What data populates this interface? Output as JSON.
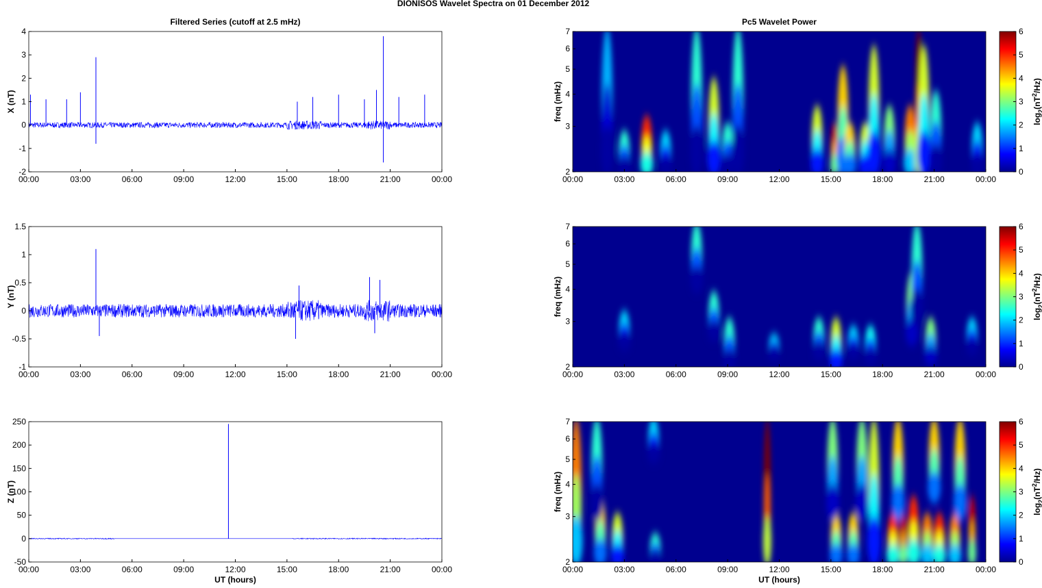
{
  "figure_title": "DIONISOS Wavelet Spectra on 01 December  2012",
  "chart_data": [
    {
      "type": "line",
      "title": "Filtered Series (cutoff at 2.5 mHz)",
      "ylabel": "X (nT)",
      "xlabel": "",
      "xlim": [
        0,
        24
      ],
      "ylim": [
        -2,
        4
      ],
      "xticks": [
        "00:00",
        "03:00",
        "06:00",
        "09:00",
        "12:00",
        "15:00",
        "18:00",
        "21:00",
        "00:00"
      ],
      "yticks": [
        -2,
        -1,
        0,
        1,
        2,
        3,
        4
      ],
      "noise_amplitude": 0.12,
      "spikes": [
        [
          3.9,
          2.9
        ],
        [
          3.9,
          -0.8
        ],
        [
          20.6,
          3.8
        ],
        [
          20.6,
          -1.6
        ],
        [
          0.1,
          1.3
        ],
        [
          1.0,
          1.1
        ],
        [
          2.2,
          1.1
        ],
        [
          3.0,
          1.4
        ],
        [
          15.6,
          1.0
        ],
        [
          16.5,
          1.2
        ],
        [
          18.0,
          1.3
        ],
        [
          19.5,
          1.1
        ],
        [
          20.2,
          1.5
        ],
        [
          21.5,
          1.2
        ],
        [
          23.0,
          1.3
        ]
      ],
      "color": "#0000ff"
    },
    {
      "type": "line",
      "title": "",
      "ylabel": "Y (nT)",
      "xlabel": "",
      "xlim": [
        0,
        24
      ],
      "ylim": [
        -1,
        1.5
      ],
      "xticks": [
        "00:00",
        "03:00",
        "06:00",
        "09:00",
        "12:00",
        "15:00",
        "18:00",
        "21:00",
        "00:00"
      ],
      "yticks": [
        -1,
        -0.5,
        0,
        0.5,
        1,
        1.5
      ],
      "noise_amplitude": 0.12,
      "spikes": [
        [
          3.9,
          1.1
        ],
        [
          4.1,
          -0.45
        ],
        [
          15.5,
          -0.5
        ],
        [
          15.7,
          0.45
        ],
        [
          19.8,
          0.6
        ],
        [
          20.1,
          -0.4
        ],
        [
          20.4,
          0.55
        ]
      ],
      "color": "#0000ff"
    },
    {
      "type": "line",
      "title": "",
      "ylabel": "Z (nT)",
      "xlabel": "UT (hours)",
      "xlim": [
        0,
        24
      ],
      "ylim": [
        -50,
        250
      ],
      "xticks": [
        "00:00",
        "03:00",
        "06:00",
        "09:00",
        "12:00",
        "15:00",
        "18:00",
        "21:00",
        "00:00"
      ],
      "yticks": [
        -50,
        0,
        50,
        100,
        150,
        200,
        250
      ],
      "noise_amplitude": 1,
      "spikes": [
        [
          11.6,
          245
        ]
      ],
      "color": "#0000ff"
    },
    {
      "type": "heatmap",
      "title": "Pc5 Wavelet Power",
      "ylabel": "freq (mHz)",
      "xlabel": "",
      "xlim": [
        0,
        24
      ],
      "ylim": [
        2,
        7
      ],
      "yscale": "log",
      "xticks": [
        "00:00",
        "03:00",
        "06:00",
        "09:00",
        "12:00",
        "15:00",
        "18:00",
        "21:00",
        "00:00"
      ],
      "yticks": [
        "2",
        "3",
        "4",
        "5",
        "6",
        "7"
      ],
      "colorbar": {
        "label": "log2(nT2/Hz)",
        "range": [
          0,
          6
        ],
        "ticks": [
          "0",
          "1",
          "2",
          "3",
          "4",
          "5",
          "6"
        ]
      },
      "blobs_hour_flo_fhi_power": [
        [
          4.3,
          2,
          3.2,
          5
        ],
        [
          3.0,
          2,
          2.8,
          2.5
        ],
        [
          5.4,
          2,
          2.8,
          2
        ],
        [
          7.2,
          2,
          7,
          2.5
        ],
        [
          8.2,
          2,
          4.5,
          3.5
        ],
        [
          9.0,
          2,
          3,
          2.5
        ],
        [
          9.6,
          2,
          7,
          2.5
        ],
        [
          2.0,
          2,
          7,
          1.8
        ],
        [
          14.2,
          2,
          3.5,
          3.5
        ],
        [
          15.2,
          2,
          3,
          5.5
        ],
        [
          15.7,
          2,
          5,
          4
        ],
        [
          16.1,
          2,
          3,
          4
        ],
        [
          17.0,
          2,
          3,
          3.5
        ],
        [
          17.5,
          2,
          6,
          3.5
        ],
        [
          18.4,
          2,
          3.5,
          3
        ],
        [
          19.6,
          2,
          3.5,
          4.5
        ],
        [
          20.1,
          2,
          7,
          6
        ],
        [
          20.4,
          2,
          6,
          3.5
        ],
        [
          21.1,
          2,
          4,
          2.5
        ],
        [
          23.5,
          2,
          3,
          2
        ]
      ]
    },
    {
      "type": "heatmap",
      "title": "",
      "ylabel": "freq (mHz)",
      "xlabel": "",
      "xlim": [
        0,
        24
      ],
      "ylim": [
        2,
        7
      ],
      "yscale": "log",
      "xticks": [
        "00:00",
        "03:00",
        "06:00",
        "09:00",
        "12:00",
        "15:00",
        "18:00",
        "21:00",
        "00:00"
      ],
      "yticks": [
        "2",
        "3",
        "4",
        "5",
        "6",
        "7"
      ],
      "colorbar": {
        "label": "log2(nT2/Hz)",
        "range": [
          0,
          6
        ],
        "ticks": [
          "0",
          "1",
          "2",
          "3",
          "4",
          "5",
          "6"
        ]
      },
      "blobs_hour_flo_fhi_power": [
        [
          3.0,
          2.4,
          3.2,
          2
        ],
        [
          7.2,
          4,
          7,
          2.5
        ],
        [
          8.2,
          2.6,
          3.8,
          2.5
        ],
        [
          9.1,
          2,
          3,
          2.5
        ],
        [
          11.7,
          2.2,
          2.6,
          2
        ],
        [
          14.3,
          2.2,
          3,
          2.5
        ],
        [
          15.3,
          2,
          3,
          3.5
        ],
        [
          16.3,
          2.2,
          2.8,
          2
        ],
        [
          17.3,
          2.1,
          2.8,
          2.3
        ],
        [
          19.7,
          2.5,
          4.5,
          3
        ],
        [
          20.0,
          3,
          7,
          2.5
        ],
        [
          20.8,
          2.1,
          3,
          3
        ],
        [
          23.2,
          2.3,
          3,
          2
        ]
      ]
    },
    {
      "type": "heatmap",
      "title": "",
      "ylabel": "freq (mHz)",
      "xlabel": "UT (hours)",
      "xlim": [
        0,
        24
      ],
      "ylim": [
        2,
        7
      ],
      "yscale": "log",
      "xticks": [
        "00:00",
        "03:00",
        "06:00",
        "09:00",
        "12:00",
        "15:00",
        "18:00",
        "21:00",
        "00:00"
      ],
      "yticks": [
        "2",
        "3",
        "4",
        "5",
        "6",
        "7"
      ],
      "colorbar": {
        "label": "log2(nT2/Hz)",
        "range": [
          0,
          6
        ],
        "ticks": [
          "0",
          "1",
          "2",
          "3",
          "4",
          "5",
          "6"
        ]
      },
      "blobs_hour_flo_fhi_power": [
        [
          0.2,
          2,
          7,
          4.5
        ],
        [
          1.6,
          2,
          3.5,
          4
        ],
        [
          2.6,
          2,
          3,
          3.5
        ],
        [
          1.4,
          3,
          7,
          2.5
        ],
        [
          4.8,
          2,
          2.5,
          2.5
        ],
        [
          4.7,
          5,
          7,
          2
        ],
        [
          11.3,
          2,
          7,
          6
        ],
        [
          15.3,
          2,
          3,
          4
        ],
        [
          15.1,
          3,
          7,
          3
        ],
        [
          16.3,
          2,
          3,
          4
        ],
        [
          17.5,
          2,
          7,
          3.5
        ],
        [
          18.6,
          2,
          3,
          5
        ],
        [
          19.2,
          2,
          3,
          5.5
        ],
        [
          19.8,
          2,
          3.5,
          5
        ],
        [
          20.6,
          2,
          3,
          4.5
        ],
        [
          21.3,
          2,
          3,
          5
        ],
        [
          22.2,
          2,
          3,
          4.5
        ],
        [
          23.2,
          2,
          3.5,
          5.5
        ],
        [
          18.9,
          3,
          7,
          4
        ],
        [
          21.0,
          3.5,
          7,
          4
        ],
        [
          22.5,
          3,
          7,
          4
        ],
        [
          16.8,
          3,
          7,
          3
        ]
      ]
    }
  ]
}
